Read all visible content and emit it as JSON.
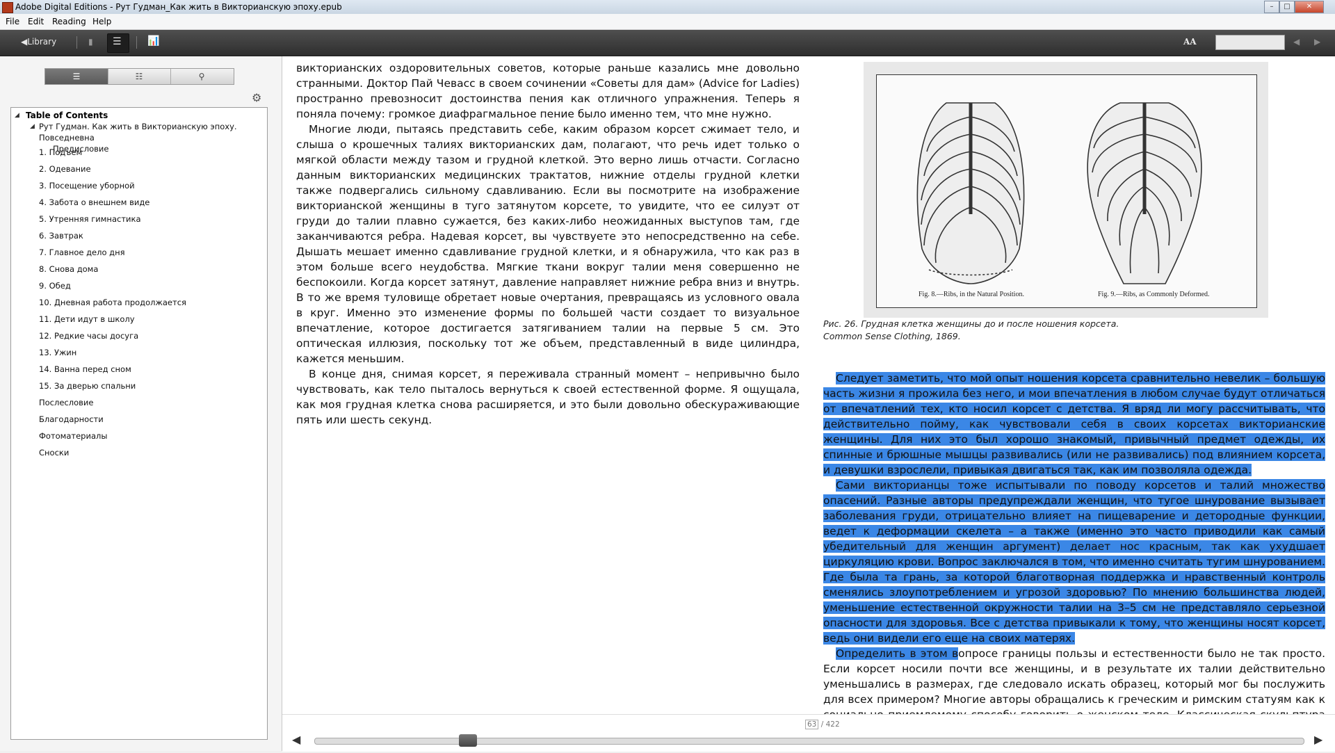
{
  "window": {
    "title": "Adobe Digital Editions - Рут Гудман_Как жить в Викторианскую эпоху.epub",
    "min_glyph": "–",
    "max_glyph": "□",
    "close_glyph": "✕"
  },
  "menu": [
    "File",
    "Edit",
    "Reading",
    "Help"
  ],
  "toolbar": {
    "library_label": "◀Library",
    "bookmark_glyph": "▮",
    "list_glyph": "☰",
    "chart_glyph": "📊",
    "font_glyph": "AA",
    "prev_glyph": "◀",
    "next_glyph": "▶",
    "search_value": ""
  },
  "sidebar": {
    "tab_glyphs": [
      "☰",
      "☷",
      "⚲"
    ],
    "gear_glyph": "⚙",
    "toc_header": "Table of Contents",
    "book_title": "Рут Гудман. Как жить в Викторианскую эпоху. Повседневна",
    "items": [
      "Предисловие",
      "1. Подъем",
      "2. Одевание",
      "3. Посещение уборной",
      "4. Забота о внешнем виде",
      "5. Утренняя гимнастика",
      "6. Завтрак",
      "7. Главное дело дня",
      "8. Снова дома",
      "9. Обед",
      "10. Дневная работа продолжается",
      "11. Дети идут в школу",
      "12. Редкие часы досуга",
      "13. Ужин",
      "14. Ванна перед сном",
      "15. За дверью спальни",
      "Послесловие",
      "Благодарности",
      "Фотоматериалы",
      "Сноски"
    ]
  },
  "left_page": {
    "p1": "викторианских оздоровительных советов, которые раньше казались мне довольно странными. Доктор Пай Чевасс в своем сочинении «Советы для дам» (Advice for Ladies) пространно превозносит достоинства пения как отличного упражнения. Теперь я поняла почему: громкое диафрагмальное пение было именно тем, что мне нужно.",
    "p2": "Многие люди, пытаясь представить себе, каким образом корсет сжимает тело, и слыша о крошечных талиях викторианских дам, полагают, что речь идет только о мягкой области между тазом и грудной клеткой. Это верно лишь отчасти. Согласно данным викторианских медицинских трактатов, нижние отделы грудной клетки также подвергались сильному сдавливанию. Если вы посмотрите на изображение викторианской женщины в туго затянутом корсете, то увидите, что ее силуэт от груди до талии плавно сужается, без каких-либо неожиданных выступов там, где заканчиваются ребра. Надевая корсет, вы чувствуете это непосредственно на себе. Дышать мешает именно сдавливание грудной клетки, и я обнаружила, что как раз в этом больше всего неудобства. Мягкие ткани вокруг талии меня совершенно не беспокоили. Когда корсет затянут, давление направляет нижние ребра вниз и внутрь. В то же время туловище обретает новые очертания, превращаясь из условного овала в круг. Именно это изменение формы по большей части создает то визуальное впечатление, которое достигается затягиванием талии на первые 5 см. Это оптическая иллюзия, поскольку тот же объем, представленный в виде цилиндра, кажется меньшим.",
    "p3": "В конце дня, снимая корсет, я переживала странный момент – непривычно было чувствовать, как тело пыталось вернуться к своей естественной форме. Я ощущала, как моя грудная клетка снова расширяется, и это были довольно обескураживающие пять или шесть секунд."
  },
  "figure": {
    "label_left": "Fig. 8.—Ribs, in the Natural Position.",
    "label_right": "Fig. 9.—Ribs, as Commonly Deformed.",
    "caption_line1": "Рис. 26. Грудная клетка женщины до и после ношения корсета.",
    "caption_line2": "Common Sense Clothing, 1869."
  },
  "right_page": {
    "p1": "Следует заметить, что мой опыт ношения корсета сравнительно невелик – большую часть жизни я прожила без него, и мои впечатления в любом случае будут отличаться от впечатлений тех, кто носил корсет с детства. Я вряд ли могу рассчитывать, что действительно пойму, как чувствовали себя в своих корсетах викторианские женщины. Для них это был хорошо знакомый, привычный предмет одежды, их спинные и брюшные мышцы развивались (или не развивались) под влиянием корсета, и девушки взрослели, привыкая двигаться так, как им позволяла одежда.",
    "p2": "Сами викторианцы тоже испытывали по поводу корсетов и талий множество опасений. Разные авторы предупреждали женщин, что тугое шнурование вызывает заболевания груди, отрицательно влияет на пищеварение и детородные функции, ведет к деформации скелета – а также (именно это часто приводили как самый убедительный для женщин аргумент) делает нос красным, так как ухудшает циркуляцию крови. Вопрос заключался в том, что именно считать тугим шнурованием. Где была та грань, за которой благотворная поддержка и нравственный контроль сменялись злоупотреблением и угрозой здоровью? По мнению большинства людей, уменьшение естественной окружности талии на 3–5 см не представляло серьезной опасности для здоровья. Все с детства привыкали к тому, что женщины носят корсет, ведь они видели его еще на своих матерях.",
    "p3_hl": "Определить в этом в",
    "p3_rest": "опросе границы пользы и естественности было не так просто. Если корсет носили почти все женщины, и в результате их талии действительно уменьшались в размерах, где следовало искать образец, который мог бы послужить для всех примером? Многие авторы обращались к греческим и римским статуям как к социально приемлемому способу говорить о женском теле. Классическая скульптура показывала обнаженные женские формы в достойном виде, и эта достойная нагота была весьма кстати лишена всяких признаков знакомства с"
  },
  "pager": {
    "current": "63",
    "total": "/ 422",
    "progress": 0.149,
    "prev_glyph": "◀",
    "next_glyph": "▶"
  }
}
